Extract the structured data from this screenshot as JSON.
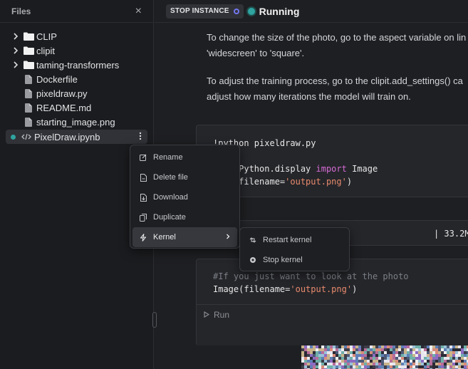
{
  "sidebar": {
    "title": "Files",
    "close_label": "×",
    "items": [
      {
        "label": "CLIP",
        "type": "folder"
      },
      {
        "label": "clipit",
        "type": "folder"
      },
      {
        "label": "taming-transformers",
        "type": "folder"
      },
      {
        "label": "Dockerfile",
        "type": "file"
      },
      {
        "label": "pixeldraw.py",
        "type": "file"
      },
      {
        "label": "README.md",
        "type": "file"
      },
      {
        "label": "starting_image.png",
        "type": "file"
      },
      {
        "label": "PixelDraw.ipynb",
        "type": "notebook",
        "active": true
      }
    ]
  },
  "topbar": {
    "stop_label": "STOP INSTANCE",
    "status_label": "Running"
  },
  "main": {
    "para1_line1": "To change the size of the photo, go to the aspect variable on lin",
    "para1_line2": "'widescreen' to 'square'.",
    "para2_line1": "To adjust the training process, go to the clipit.add_settings() ca",
    "para2_line2": "adjust how many iterations the model will train on.",
    "cell1": {
      "line1": "!python pixeldraw.py",
      "line3_pre": "IPython.display ",
      "line3_kw": "import",
      "line3_post": " Image",
      "line4_pre": "(filename=",
      "line4_str": "'output.png'",
      "line4_post": ")"
    },
    "output_text": "| 33.2M/2",
    "cell2": {
      "comment": "#If you just want to look at the photo",
      "line2_pre": "Image(filename=",
      "line2_str": "'output.png'",
      "line2_post": ")"
    },
    "run_label": "Run"
  },
  "context_menu": {
    "items": [
      {
        "label": "Rename",
        "icon": "edit-icon"
      },
      {
        "label": "Delete file",
        "icon": "file-minus-icon"
      },
      {
        "label": "Download",
        "icon": "download-icon"
      },
      {
        "label": "Duplicate",
        "icon": "copy-icon"
      },
      {
        "label": "Kernel",
        "icon": "bolt-icon",
        "highlighted": true
      }
    ],
    "submenu": [
      {
        "label": "Restart kernel",
        "icon": "restart-icon"
      },
      {
        "label": "Stop kernel",
        "icon": "stop-icon"
      }
    ]
  },
  "colors": {
    "accent_teal": "#2fa4a0",
    "stop_purple": "#7577f0",
    "keyword": "#d66bd5",
    "string": "#e88a6d"
  }
}
